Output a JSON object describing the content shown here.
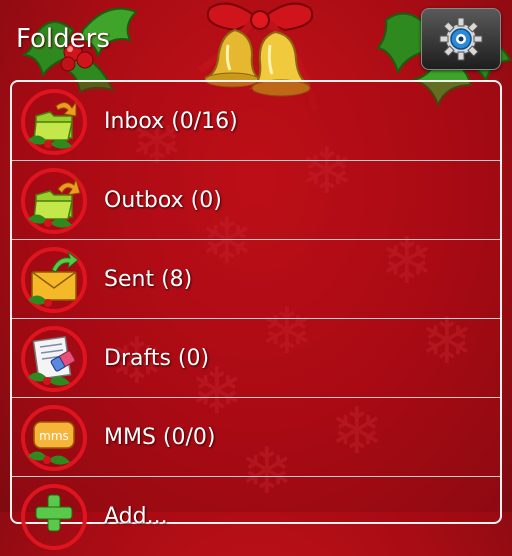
{
  "header": {
    "title": "Folders",
    "settings_icon": "gear-icon"
  },
  "folders": [
    {
      "label": "Inbox (0/16)",
      "icon": "inbox-folder-icon"
    },
    {
      "label": "Outbox (0)",
      "icon": "outbox-folder-icon"
    },
    {
      "label": "Sent (8)",
      "icon": "sent-envelope-icon"
    },
    {
      "label": "Drafts (0)",
      "icon": "drafts-notepad-icon"
    },
    {
      "label": "MMS (0/0)",
      "icon": "mms-icon",
      "badge": "mms"
    },
    {
      "label": "Add...",
      "icon": "add-folder-icon"
    }
  ],
  "colors": {
    "background": "#a80c14",
    "text": "#ffffff",
    "icon_ring": "#e0141e"
  }
}
